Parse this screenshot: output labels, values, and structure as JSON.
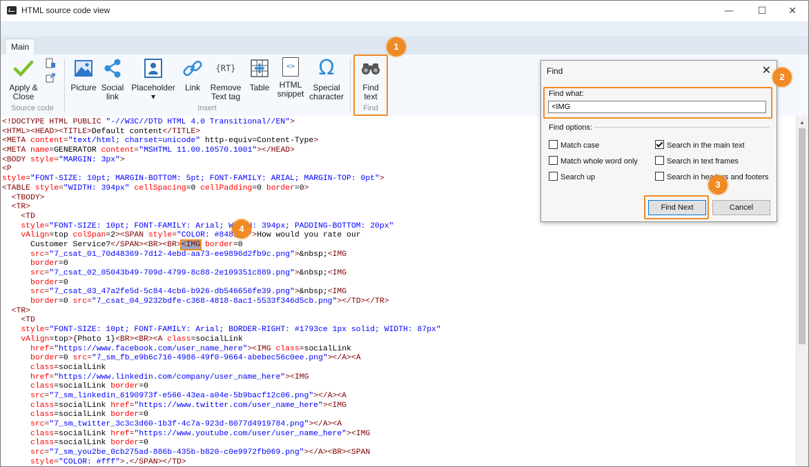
{
  "window": {
    "title": "HTML source code view",
    "minimize_glyph": "—",
    "maximize_glyph": "☐",
    "close_glyph": "✕"
  },
  "ribbon": {
    "tab": "Main",
    "source_code": {
      "apply_close_line1": "Apply &",
      "apply_close_line2": "Close",
      "group_label": "Source code"
    },
    "insert": {
      "picture": "Picture",
      "social_line1": "Social",
      "social_line2": "link",
      "placeholder": "Placeholder",
      "placeholder_arrow": "▾",
      "link": "Link",
      "remove_line1": "Remove",
      "remove_line2": "Text tag",
      "table": "Table",
      "snippet_line1": "HTML",
      "snippet_line2": "snippet",
      "special_line1": "Special",
      "special_line2": "character",
      "group_label": "Insert",
      "rt_glyph": "{RT}",
      "omega_glyph": "Ω",
      "snippet_glyph": "<>"
    },
    "find": {
      "line1": "Find",
      "line2": "text",
      "group_label": "Find"
    }
  },
  "badges": [
    "1",
    "2",
    "3",
    "4"
  ],
  "find_dialog": {
    "title": "Find",
    "close_glyph": "✕",
    "find_what_label": "Find what:",
    "find_what_value": "<IMG",
    "options_label": "Find options:",
    "options": [
      {
        "label": "Match case",
        "checked": false
      },
      {
        "label": "Search in the main text",
        "checked": true
      },
      {
        "label": "Match whole word only",
        "checked": false
      },
      {
        "label": "Search in text frames",
        "checked": false
      },
      {
        "label": "Search up",
        "checked": false
      },
      {
        "label": "Search in headers and footers",
        "checked": false
      }
    ],
    "find_next": "Find Next",
    "cancel": "Cancel"
  },
  "code_lines": [
    [
      [
        "t",
        "<!DOCTYPE HTML PUBLIC "
      ],
      [
        "v",
        "\"-//W3C//DTD HTML 4.0 Transitional//EN\""
      ],
      [
        "t",
        ">"
      ]
    ],
    [
      [
        "t",
        "<HTML><HEAD><TITLE>"
      ],
      [
        "x",
        "Default content"
      ],
      [
        "t",
        "</TITLE>"
      ]
    ],
    [
      [
        "t",
        "<META "
      ],
      [
        "a",
        "content"
      ],
      [
        "t",
        "="
      ],
      [
        "v",
        "\"text/html; charset=unicode\""
      ],
      [
        "x",
        " http-equiv=Content-Type"
      ],
      [
        "t",
        ">"
      ]
    ],
    [
      [
        "t",
        "<META "
      ],
      [
        "a",
        "name"
      ],
      [
        "x",
        "=GENERATOR "
      ],
      [
        "a",
        "content"
      ],
      [
        "t",
        "="
      ],
      [
        "v",
        "\"MSHTML 11.00.10570.1001\""
      ],
      [
        "t",
        "></HEAD>"
      ]
    ],
    [
      [
        "t",
        "<BODY "
      ],
      [
        "a",
        "style"
      ],
      [
        "t",
        "="
      ],
      [
        "v",
        "\"MARGIN: 3px\""
      ],
      [
        "t",
        ">"
      ]
    ],
    [
      [
        "t",
        "<P"
      ]
    ],
    [
      [
        "a",
        "style"
      ],
      [
        "t",
        "="
      ],
      [
        "v",
        "\"FONT-SIZE: 10pt; MARGIN-BOTTOM: 5pt; FONT-FAMILY: ARIAL; MARGIN-TOP: 0pt\""
      ],
      [
        "t",
        ">"
      ]
    ],
    [
      [
        "t",
        "<TABLE "
      ],
      [
        "a",
        "style"
      ],
      [
        "t",
        "="
      ],
      [
        "v",
        "\"WIDTH: 394px\""
      ],
      [
        "a",
        " cellSpacing"
      ],
      [
        "x",
        "=0 "
      ],
      [
        "a",
        "cellPadding"
      ],
      [
        "x",
        "=0 "
      ],
      [
        "a",
        "border"
      ],
      [
        "x",
        "=0"
      ],
      [
        "t",
        ">"
      ]
    ],
    [
      [
        "x",
        "  "
      ],
      [
        "t",
        "<TBODY>"
      ]
    ],
    [
      [
        "x",
        "  "
      ],
      [
        "t",
        "<TR>"
      ]
    ],
    [
      [
        "x",
        "    "
      ],
      [
        "t",
        "<TD"
      ]
    ],
    [
      [
        "x",
        "    "
      ],
      [
        "a",
        "style"
      ],
      [
        "t",
        "="
      ],
      [
        "v",
        "\"FONT-SIZE: 10pt; FONT-FAMILY: Arial; WIDTH: 394px; PADDING-BOTTOM: 20px\""
      ]
    ],
    [
      [
        "x",
        "    "
      ],
      [
        "a",
        "vAlign"
      ],
      [
        "x",
        "=top "
      ],
      [
        "a",
        "colSpan"
      ],
      [
        "x",
        "=2"
      ],
      [
        "t",
        "><SPAN "
      ],
      [
        "a",
        "style"
      ],
      [
        "t",
        "="
      ],
      [
        "v",
        "\"COLOR: #848181\""
      ],
      [
        "t",
        ">"
      ],
      [
        "x",
        "How would you rate our"
      ]
    ],
    [
      [
        "x",
        "      Customer Service?"
      ],
      [
        "t",
        "</SPAN><BR><BR>"
      ],
      [
        "s",
        "<IMG"
      ],
      [
        "a",
        " border"
      ],
      [
        "x",
        "=0"
      ]
    ],
    [
      [
        "x",
        "      "
      ],
      [
        "a",
        "src"
      ],
      [
        "t",
        "="
      ],
      [
        "v",
        "\"7_csat_01_70d48369-7d12-4ebd-aa73-ee9896d2fb9c.png\""
      ],
      [
        "t",
        ">"
      ],
      [
        "x",
        "&nbsp;"
      ],
      [
        "t",
        "<IMG"
      ]
    ],
    [
      [
        "x",
        "      "
      ],
      [
        "a",
        "border"
      ],
      [
        "x",
        "=0"
      ]
    ],
    [
      [
        "x",
        "      "
      ],
      [
        "a",
        "src"
      ],
      [
        "t",
        "="
      ],
      [
        "v",
        "\"7_csat_02_05043b49-709d-4799-8c88-2e109351c889.png\""
      ],
      [
        "t",
        ">"
      ],
      [
        "x",
        "&nbsp;"
      ],
      [
        "t",
        "<IMG"
      ]
    ],
    [
      [
        "x",
        "      "
      ],
      [
        "a",
        "border"
      ],
      [
        "x",
        "=0"
      ]
    ],
    [
      [
        "x",
        "      "
      ],
      [
        "a",
        "src"
      ],
      [
        "t",
        "="
      ],
      [
        "v",
        "\"7_csat_03_47a2fe5d-5c84-4cb6-b926-db546656fe39.png\""
      ],
      [
        "t",
        ">"
      ],
      [
        "x",
        "&nbsp;"
      ],
      [
        "t",
        "<IMG"
      ]
    ],
    [
      [
        "x",
        "      "
      ],
      [
        "a",
        "border"
      ],
      [
        "x",
        "=0 "
      ],
      [
        "a",
        "src"
      ],
      [
        "t",
        "="
      ],
      [
        "v",
        "\"7_csat_04_9232bdfe-c368-4818-8ac1-5533f346d5cb.png\""
      ],
      [
        "t",
        "></TD></TR>"
      ]
    ],
    [
      [
        "x",
        "  "
      ],
      [
        "t",
        "<TR>"
      ]
    ],
    [
      [
        "x",
        "    "
      ],
      [
        "t",
        "<TD"
      ]
    ],
    [
      [
        "x",
        "    "
      ],
      [
        "a",
        "style"
      ],
      [
        "t",
        "="
      ],
      [
        "v",
        "\"FONT-SIZE: 10pt; FONT-FAMILY: Arial; BORDER-RIGHT: #1793ce 1px solid; WIDTH: 87px\""
      ]
    ],
    [
      [
        "x",
        "    "
      ],
      [
        "a",
        "vAlign"
      ],
      [
        "x",
        "=top"
      ],
      [
        "t",
        ">"
      ],
      [
        "x",
        "{Photo 1}"
      ],
      [
        "t",
        "<BR><BR><A "
      ],
      [
        "a",
        "class"
      ],
      [
        "x",
        "=socialLink"
      ]
    ],
    [
      [
        "x",
        "      "
      ],
      [
        "a",
        "href"
      ],
      [
        "t",
        "="
      ],
      [
        "v",
        "\"https://www.facebook.com/user_name_here\""
      ],
      [
        "t",
        "><IMG "
      ],
      [
        "a",
        "class"
      ],
      [
        "x",
        "=socialLink"
      ]
    ],
    [
      [
        "x",
        "      "
      ],
      [
        "a",
        "border"
      ],
      [
        "x",
        "=0 "
      ],
      [
        "a",
        "src"
      ],
      [
        "t",
        "="
      ],
      [
        "v",
        "\"7_sm_fb_e9b6c716-4986-49f0-9664-abebec56c0ee.png\""
      ],
      [
        "t",
        "></A><A"
      ]
    ],
    [
      [
        "x",
        "      "
      ],
      [
        "a",
        "class"
      ],
      [
        "x",
        "=socialLink"
      ]
    ],
    [
      [
        "x",
        "      "
      ],
      [
        "a",
        "href"
      ],
      [
        "t",
        "="
      ],
      [
        "v",
        "\"https://www.linkedin.com/company/user_name_here\""
      ],
      [
        "t",
        "><IMG"
      ]
    ],
    [
      [
        "x",
        "      "
      ],
      [
        "a",
        "class"
      ],
      [
        "x",
        "=socialLink "
      ],
      [
        "a",
        "border"
      ],
      [
        "x",
        "=0"
      ]
    ],
    [
      [
        "x",
        "      "
      ],
      [
        "a",
        "src"
      ],
      [
        "t",
        "="
      ],
      [
        "v",
        "\"7_sm_linkedin_6190973f-e566-43ea-a04e-5b9bacf12c06.png\""
      ],
      [
        "t",
        "></A><A"
      ]
    ],
    [
      [
        "x",
        "      "
      ],
      [
        "a",
        "class"
      ],
      [
        "x",
        "=socialLink "
      ],
      [
        "a",
        "href"
      ],
      [
        "t",
        "="
      ],
      [
        "v",
        "\"https://www.twitter.com/user_name_here\""
      ],
      [
        "t",
        "><IMG"
      ]
    ],
    [
      [
        "x",
        "      "
      ],
      [
        "a",
        "class"
      ],
      [
        "x",
        "=socialLink "
      ],
      [
        "a",
        "border"
      ],
      [
        "x",
        "=0"
      ]
    ],
    [
      [
        "x",
        "      "
      ],
      [
        "a",
        "src"
      ],
      [
        "t",
        "="
      ],
      [
        "v",
        "\"7_sm_twitter_3c3c3d60-1b3f-4c7a-923d-8077d4919784.png\""
      ],
      [
        "t",
        "></A><A"
      ]
    ],
    [
      [
        "x",
        "      "
      ],
      [
        "a",
        "class"
      ],
      [
        "x",
        "=socialLink "
      ],
      [
        "a",
        "href"
      ],
      [
        "t",
        "="
      ],
      [
        "v",
        "\"https://www.youtube.com/user/user_name_here\""
      ],
      [
        "t",
        "><IMG"
      ]
    ],
    [
      [
        "x",
        "      "
      ],
      [
        "a",
        "class"
      ],
      [
        "x",
        "=socialLink "
      ],
      [
        "a",
        "border"
      ],
      [
        "x",
        "=0"
      ]
    ],
    [
      [
        "x",
        "      "
      ],
      [
        "a",
        "src"
      ],
      [
        "t",
        "="
      ],
      [
        "v",
        "\"7_sm_you2be_0cb275ad-886b-435b-b820-c0e9972fb069.png\""
      ],
      [
        "t",
        "></A><BR><SPAN"
      ]
    ],
    [
      [
        "x",
        "      "
      ],
      [
        "a",
        "style"
      ],
      [
        "t",
        "="
      ],
      [
        "v",
        "\"COLOR: #fff\""
      ],
      [
        "t",
        ">"
      ],
      [
        "x",
        "."
      ],
      [
        "t",
        "</SPAN></TD>"
      ]
    ]
  ]
}
